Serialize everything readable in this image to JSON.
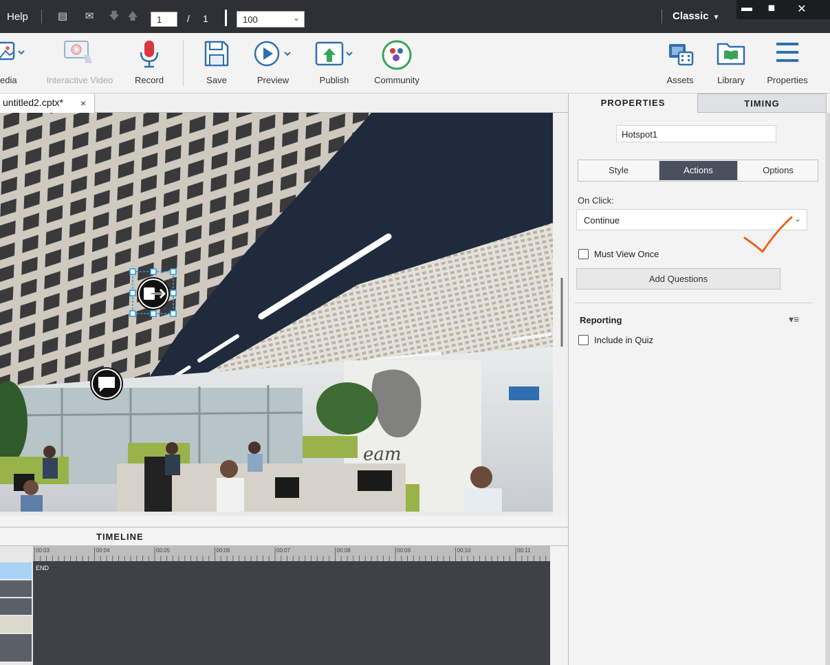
{
  "menubar": {
    "help": "Help",
    "page_current": "1",
    "page_separator": "/",
    "page_total": "1",
    "zoom": "100",
    "workspace": "Classic",
    "icons": [
      "slides-icon",
      "mail-icon",
      "arrow-down-icon",
      "arrow-up-icon"
    ]
  },
  "window_controls": {
    "minimize": "▬",
    "maximize": "◼",
    "close": "✕"
  },
  "toolbar": {
    "items": [
      {
        "label": "Media",
        "visible_label": "edia",
        "icon": "media-icon"
      },
      {
        "label": "Interactive Video",
        "icon": "interactive-video-icon",
        "disabled": true
      },
      {
        "label": "Record",
        "icon": "microphone-icon"
      },
      {
        "label": "Save",
        "icon": "save-icon"
      },
      {
        "label": "Preview",
        "icon": "preview-icon"
      },
      {
        "label": "Publish",
        "icon": "publish-icon"
      },
      {
        "label": "Community",
        "icon": "community-icon"
      },
      {
        "label": "Assets",
        "icon": "assets-icon"
      },
      {
        "label": "Library",
        "icon": "library-icon"
      },
      {
        "label": "Properties",
        "icon": "properties-icon"
      }
    ],
    "accent": "#2f6fb0",
    "record_color": "#d9363e"
  },
  "document_tab": {
    "title": "untitled2.cptx*",
    "close": "×"
  },
  "timeline": {
    "title": "TIMELINE",
    "ticks": [
      "00:03",
      "00:04",
      "00:05",
      "00:06",
      "00:07",
      "00:08",
      "00:09",
      "00:10",
      "00:11"
    ],
    "end_label": "END"
  },
  "properties_panel": {
    "tabs": [
      "PROPERTIES",
      "TIMING"
    ],
    "active_tab": "PROPERTIES",
    "object_name": "Hotspot1",
    "subtabs": [
      "Style",
      "Actions",
      "Options"
    ],
    "active_subtab": "Actions",
    "on_click_label": "On Click:",
    "on_click_value": "Continue",
    "must_view_once": "Must View Once",
    "add_questions": "Add Questions",
    "reporting": "Reporting",
    "include_in_quiz": "Include in Quiz"
  },
  "annotation_color": "#e8641e",
  "hotspot_icons": [
    "exit-icon",
    "chat-icon"
  ]
}
